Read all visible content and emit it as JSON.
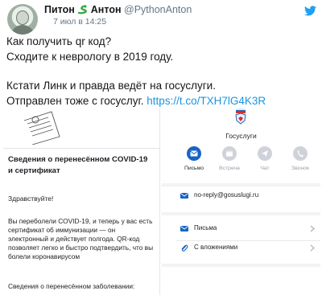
{
  "tweet": {
    "author_name": "Питон",
    "author_name_2": "Антон",
    "handle": "@PythonAnton",
    "date": "7 июл в 14:25",
    "lines": [
      "Как получить qr код?",
      "Сходите к неврологу в 2019 году.",
      "Кстати Линк и правда ведёт на госуслуги.",
      "Отправлен тоже с госуслуг."
    ],
    "link": "https://t.co/TXH7lG4K3R"
  },
  "email": {
    "title": "Сведения о перенесённом COVID-19 и сертификат",
    "greeting": "Здравствуйте!",
    "body": "Вы переболели COVID-19, и теперь у вас есть сертификат об иммунизации — он электронный и действует полгода. QR-код позволяет легко и быстро подтвердить, что вы болели коронавирусом",
    "footer": "Сведения о перенесённом заболевании:"
  },
  "mail_app": {
    "sender": "Госуслуги",
    "actions": [
      {
        "label": "Письмо",
        "icon": "envelope-icon",
        "active": true
      },
      {
        "label": "Встреча",
        "icon": "calendar-icon",
        "active": false
      },
      {
        "label": "Чат",
        "icon": "chat-icon",
        "active": false
      },
      {
        "label": "Звонок",
        "icon": "phone-icon",
        "active": false
      }
    ],
    "email_address": "no-reply@gosuslugi.ru",
    "rows": [
      {
        "label": "Письма",
        "icon": "envelope-icon"
      },
      {
        "label": "С вложениями",
        "icon": "paperclip-icon"
      }
    ]
  },
  "colors": {
    "twitter_blue": "#1da1f2",
    "link": "#1b95e0",
    "mail_accent": "#1764c4",
    "snake_green": "#3aa845"
  }
}
